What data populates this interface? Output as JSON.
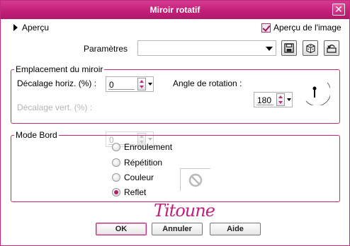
{
  "window": {
    "title": "Miroir rotatif"
  },
  "preview": {
    "toggle_label": "Aperçu",
    "image_preview_label": "Aperçu de l'image",
    "image_preview_checked": true
  },
  "parameters": {
    "label": "Paramètres",
    "value": ""
  },
  "mirror_location": {
    "legend": "Emplacement du miroir",
    "horiz_label": "Décalage horiz. (%) :",
    "horiz_value": "0",
    "vert_label": "Décalage vert. (%) :",
    "vert_value": "0",
    "angle_label": "Angle de rotation :",
    "angle_value": "180"
  },
  "edge_mode": {
    "legend": "Mode Bord",
    "options": [
      "Enroulement",
      "Répétition",
      "Couleur",
      "Reflet"
    ],
    "selected": "Reflet"
  },
  "signature": "Titoune",
  "buttons": {
    "ok": "OK",
    "cancel": "Annuler",
    "help": "Aide"
  },
  "colors": {
    "accent": "#c22078",
    "frame": "#c9257f"
  }
}
